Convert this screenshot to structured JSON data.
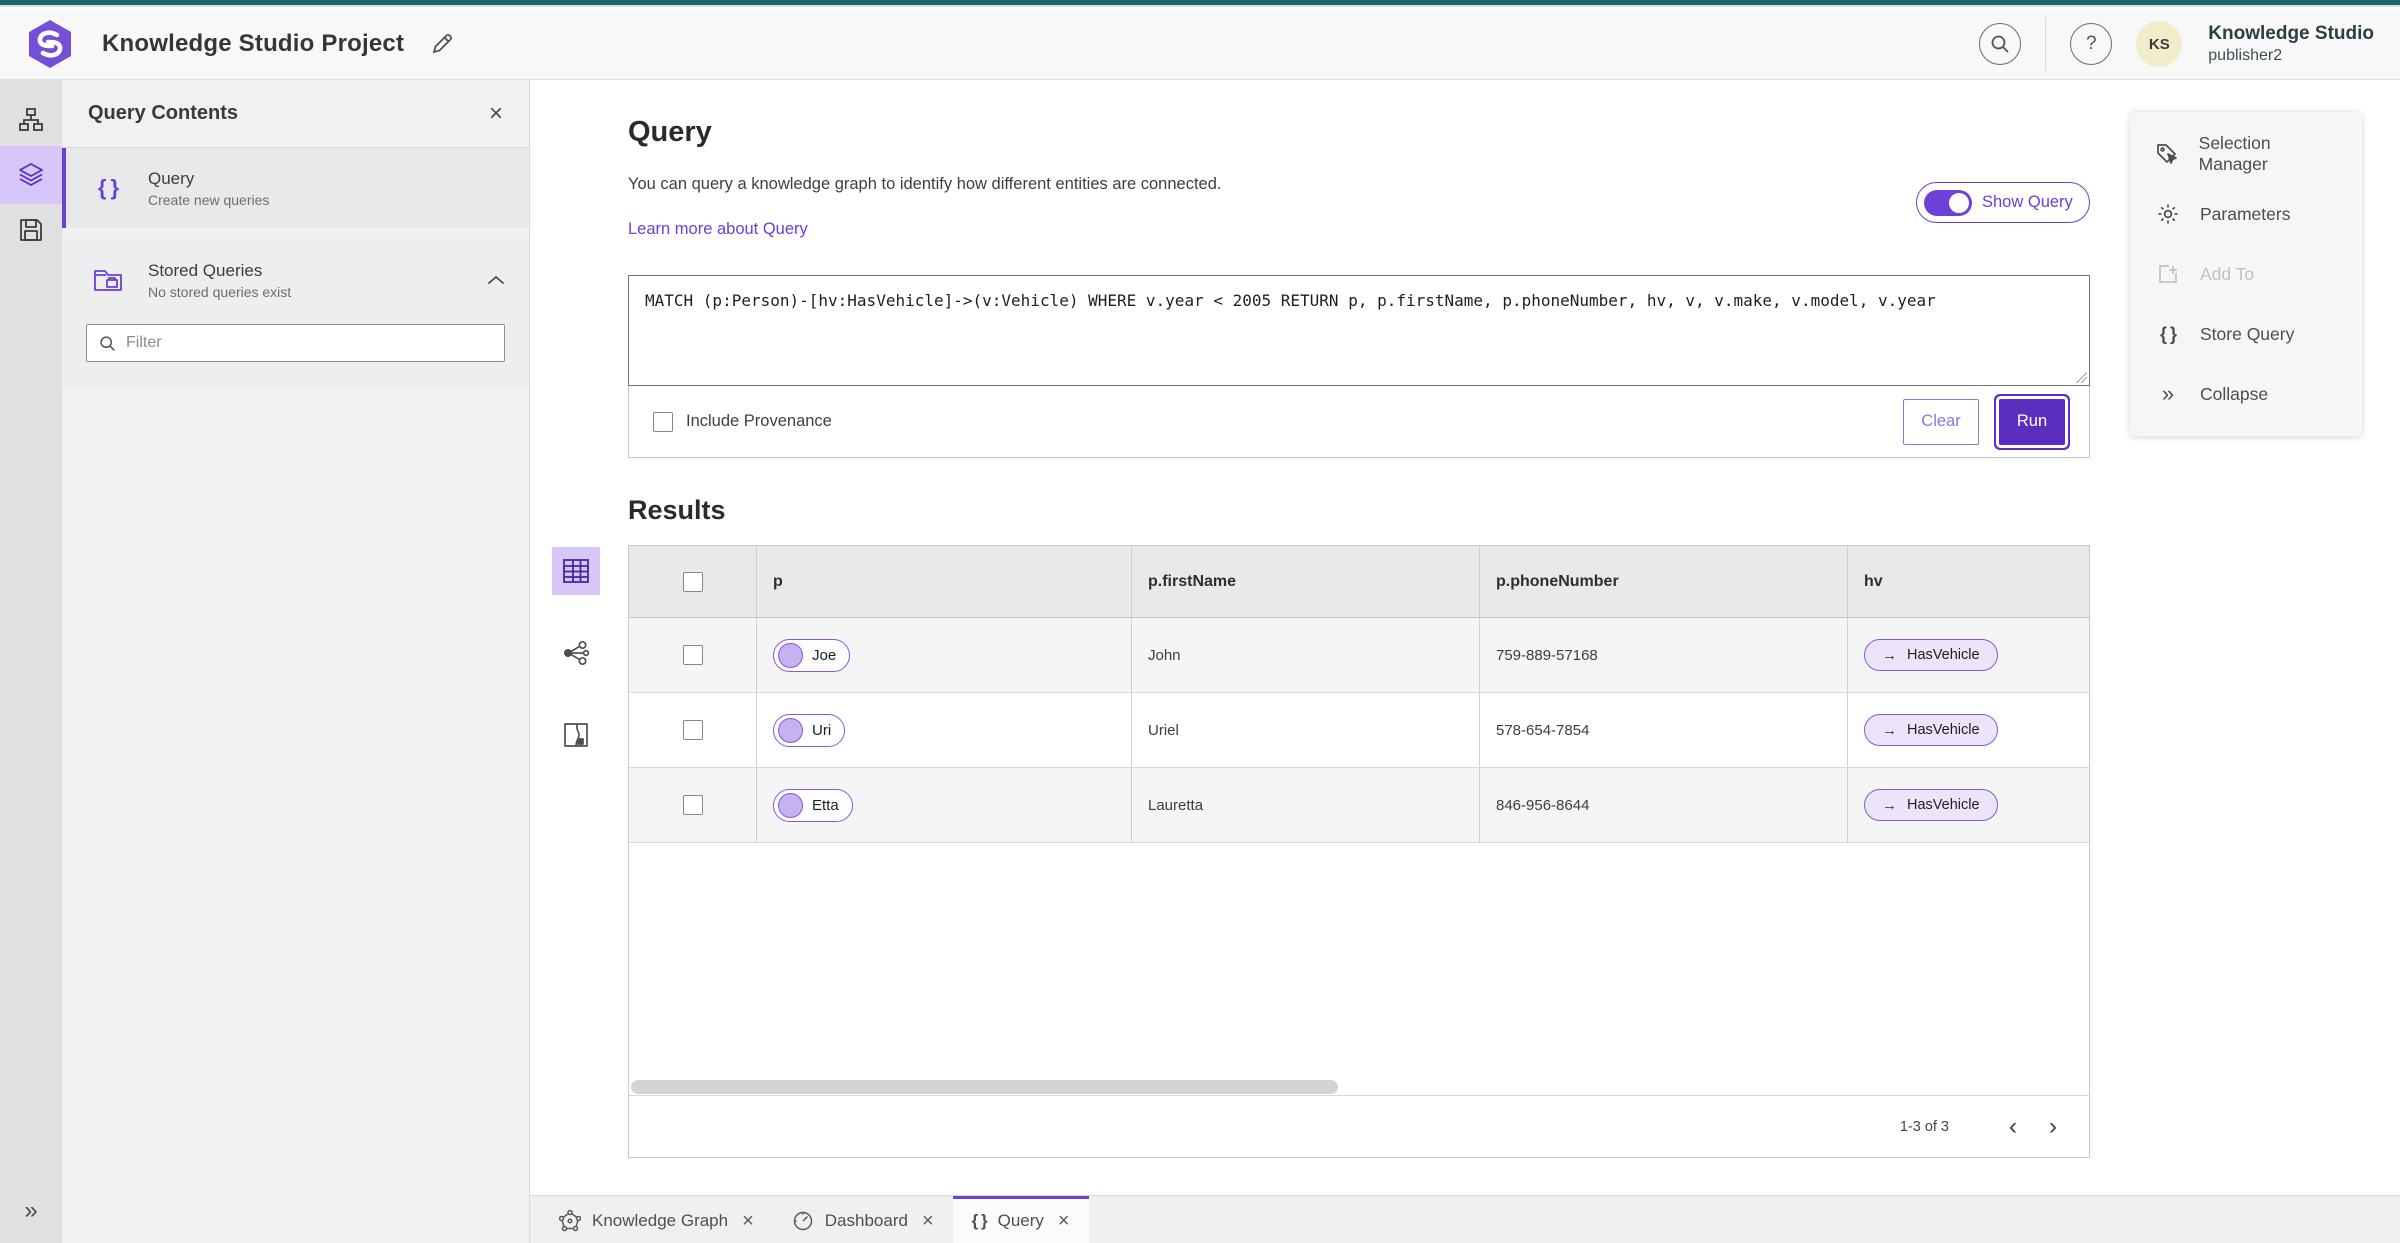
{
  "app": {
    "title": "Knowledge Studio Project",
    "user": {
      "initials": "KS",
      "name": "Knowledge Studio",
      "role": "publisher2"
    }
  },
  "glyphs": {
    "close": "×",
    "braces": "{ }",
    "arrow": "→",
    "chevrons_right": "»",
    "chevron_left": "‹",
    "chevron_right": "›",
    "help": "?"
  },
  "colors": {
    "accent": "#6741d9",
    "run_button": "#5b2ebf",
    "top_bar_teal": "#1e656c",
    "active_highlight": "#d6c7f8",
    "pill_fill": "#c7b2f1",
    "avatar_bg": "#f1edc8"
  },
  "left_panel": {
    "title": "Query Contents",
    "query_item": {
      "label": "Query",
      "sublabel": "Create new queries"
    },
    "stored_item": {
      "label": "Stored Queries",
      "sublabel": "No stored queries exist"
    },
    "filter_placeholder": "Filter"
  },
  "query_section": {
    "heading": "Query",
    "description": "You can query a knowledge graph to identify how different entities are connected.",
    "learn_more": "Learn more about Query",
    "show_query": "Show Query",
    "query_text": "MATCH (p:Person)-[hv:HasVehicle]->(v:Vehicle) WHERE v.year < 2005 RETURN p, p.firstName, p.phoneNumber, hv, v, v.make, v.model, v.year",
    "include_provenance": "Include Provenance",
    "clear": "Clear",
    "run": "Run"
  },
  "tools_panel": {
    "selection_manager": "Selection Manager",
    "parameters": "Parameters",
    "add_to": "Add To",
    "store_query": "Store Query",
    "collapse": "Collapse"
  },
  "results": {
    "heading": "Results",
    "columns": [
      "p",
      "p.firstName",
      "p.phoneNumber",
      "hv"
    ],
    "rows": [
      {
        "p": "Joe",
        "firstName": "John",
        "phone": "759-889-57168",
        "hv": "HasVehicle"
      },
      {
        "p": "Uri",
        "firstName": "Uriel",
        "phone": "578-654-7854",
        "hv": "HasVehicle"
      },
      {
        "p": "Etta",
        "firstName": "Lauretta",
        "phone": "846-956-8644",
        "hv": "HasVehicle"
      }
    ],
    "pagination": "1-3 of 3"
  },
  "tabs": [
    {
      "label": "Knowledge Graph"
    },
    {
      "label": "Dashboard"
    },
    {
      "label": "Query"
    }
  ]
}
